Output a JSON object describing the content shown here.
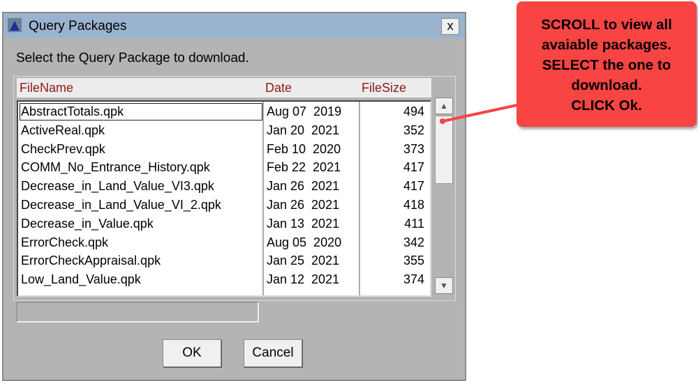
{
  "window": {
    "title": "Query Packages",
    "close_label": "x"
  },
  "prompt": "Select the Query Package to download.",
  "columns": {
    "name": "FileName",
    "date": "Date",
    "size": "FileSize"
  },
  "rows": [
    {
      "name": "AbstractTotals.qpk",
      "date": "Aug 07  2019",
      "size": "494"
    },
    {
      "name": "ActiveReal.qpk",
      "date": "Jan 20  2021",
      "size": "352"
    },
    {
      "name": "CheckPrev.qpk",
      "date": "Feb 10  2020",
      "size": "373"
    },
    {
      "name": "COMM_No_Entrance_History.qpk",
      "date": "Feb 22  2021",
      "size": "417"
    },
    {
      "name": "Decrease_in_Land_Value_VI3.qpk",
      "date": "Jan 26  2021",
      "size": "417"
    },
    {
      "name": "Decrease_in_Land_Value_VI_2.qpk",
      "date": "Jan 26  2021",
      "size": "418"
    },
    {
      "name": "Decrease_in_Value.qpk",
      "date": "Jan 13  2021",
      "size": "411"
    },
    {
      "name": "ErrorCheck.qpk",
      "date": "Aug 05  2020",
      "size": "342"
    },
    {
      "name": "ErrorCheckAppraisal.qpk",
      "date": "Jan 25  2021",
      "size": "355"
    },
    {
      "name": "Low_Land_Value.qpk",
      "date": "Jan 12  2021",
      "size": "374"
    }
  ],
  "buttons": {
    "ok": "OK",
    "cancel": "Cancel"
  },
  "callout": "SCROLL to view all\navaiable packages.\nSELECT the one to\ndownload.\nCLICK Ok.",
  "colors": {
    "callout": "#f94444",
    "titlebar": "#9ab3cf",
    "header_text": "#8b1a1a"
  }
}
